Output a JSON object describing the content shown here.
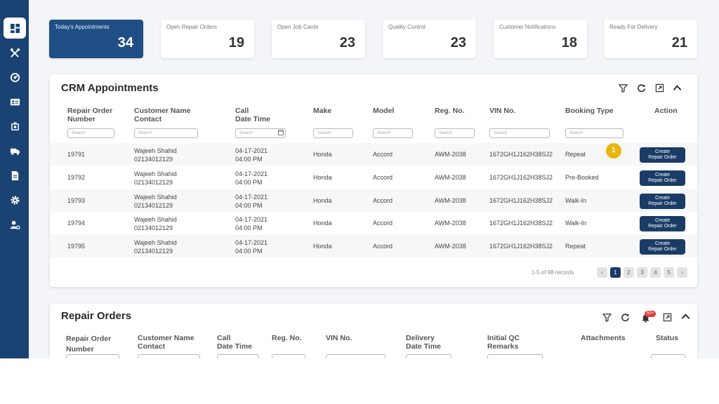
{
  "sidebar": {
    "items": [
      {
        "icon": "dashboard-icon",
        "active": true
      },
      {
        "icon": "tools-icon"
      },
      {
        "icon": "gauge-icon"
      },
      {
        "icon": "id-card-icon"
      },
      {
        "icon": "engine-icon"
      },
      {
        "icon": "truck-icon"
      },
      {
        "icon": "document-icon"
      },
      {
        "icon": "gear-icon"
      },
      {
        "icon": "user-settings-icon"
      }
    ],
    "color": "#1a4373"
  },
  "stats": [
    {
      "label": "Today's Appointments",
      "value": "34"
    },
    {
      "label": "Open Repair Orders",
      "value": "19"
    },
    {
      "label": "Open Job Cards",
      "value": "23"
    },
    {
      "label": "Quality Control",
      "value": "23"
    },
    {
      "label": "Customer Notifications",
      "value": "18"
    },
    {
      "label": "Ready For Delivery",
      "value": "21"
    }
  ],
  "crm": {
    "title": "CRM Appointments",
    "headers": {
      "repair_order": "Repair Order\nNumber",
      "customer": "Customer Name\nContact",
      "call": "Call\nDate Time",
      "make": "Make",
      "model": "Model",
      "reg": "Reg. No.",
      "vin": "VIN No.",
      "booking": "Booking Type",
      "action": "Action"
    },
    "search_placeholder": "Search",
    "rows": [
      {
        "ro": "19791",
        "name": "Wajeeh Shahid",
        "phone": "02134012129",
        "date": "04-17-2021",
        "time": "04:00 PM",
        "make": "Honda",
        "model": "Accord",
        "reg": "AWM-2038",
        "vin": "1672GH1J162H38SJ2",
        "booking": "Repeat",
        "action": "Create\nRepair Order"
      },
      {
        "ro": "19792",
        "name": "Wajeeh Shahid",
        "phone": "02134012129",
        "date": "04-17-2021",
        "time": "04:00 PM",
        "make": "Honda",
        "model": "Accord",
        "reg": "AWM-2038",
        "vin": "1672GH1J162H38SJ2",
        "booking": "Pre-Booked",
        "action": "Create\nRepair Order"
      },
      {
        "ro": "19793",
        "name": "Wajeeh Shahid",
        "phone": "02134012129",
        "date": "04-17-2021",
        "time": "04:00 PM",
        "make": "Honda",
        "model": "Accord",
        "reg": "AWM-2038",
        "vin": "1672GH1J162H38SJ2",
        "booking": "Walk-In",
        "action": "Create\nRepair Order"
      },
      {
        "ro": "19794",
        "name": "Wajeeh Shahid",
        "phone": "02134012129",
        "date": "04-17-2021",
        "time": "04:00 PM",
        "make": "Honda",
        "model": "Accord",
        "reg": "AWM-2038",
        "vin": "1672GH1J162H38SJ2",
        "booking": "Walk-In",
        "action": "Create\nRepair Order"
      },
      {
        "ro": "19795",
        "name": "Wajeeh Shahid",
        "phone": "02134012129",
        "date": "04-17-2021",
        "time": "04:00 PM",
        "make": "Honda",
        "model": "Accord",
        "reg": "AWM-2038",
        "vin": "1672GH1J162H38SJ2",
        "booking": "Repeat",
        "action": "Create\nRepair Order"
      }
    ],
    "badge": "1",
    "records": "1-5 of 98 records",
    "pagination": {
      "prev": "‹",
      "pages": [
        "1",
        "2",
        "3",
        "4",
        "5"
      ],
      "next": "›"
    }
  },
  "repair_orders": {
    "title": "Repair Orders",
    "bell_count": "50+",
    "headers": {
      "repair_order": "Repair Order\nNumber",
      "customer": "Customer Name\nContact",
      "call": "Call\nDate Time",
      "reg": "Reg. No.",
      "vin": "VIN No.",
      "delivery": "Delivery\nDate Time",
      "qc": "Initial QC\nRemarks",
      "attachments": "Attachments",
      "status": "Status"
    }
  },
  "colors": {
    "primary": "#1a3c66",
    "accent_badge": "#e8b60e",
    "notification": "#e33b3b"
  }
}
